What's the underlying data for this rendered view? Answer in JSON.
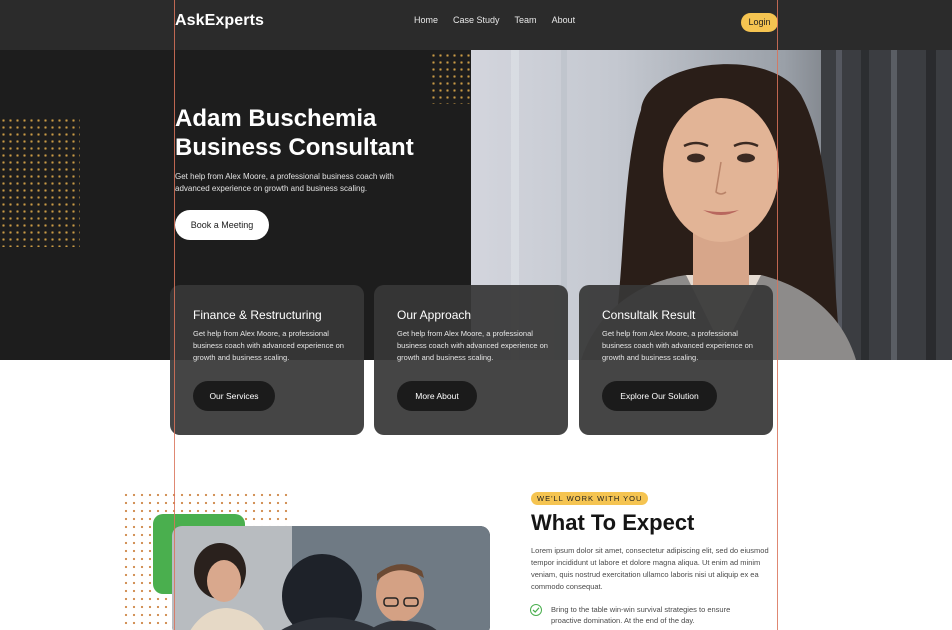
{
  "nav": {
    "logo": "AskExperts",
    "items": [
      "Home",
      "Case Study",
      "Team",
      "About"
    ],
    "login": "Login"
  },
  "hero": {
    "title": "Adam Buschemia Business Consultant",
    "description": "Get help from Alex Moore, a professional business coach with advanced experience on growth and business scaling.",
    "cta": "Book a Meeting"
  },
  "cards": [
    {
      "title": "Finance & Restructuring",
      "text": "Get help from Alex Moore, a professional business coach with advanced experience on growth and business scaling.",
      "button": "Our Services"
    },
    {
      "title": "Our Approach",
      "text": "Get help from Alex Moore, a professional business coach with advanced experience on growth and business scaling.",
      "button": "More About"
    },
    {
      "title": "Consultalk Result",
      "text": "Get help from Alex Moore, a professional business coach with advanced experience on growth and business scaling.",
      "button": "Explore Our Solution"
    }
  ],
  "expect": {
    "tag": "WE'LL WORK WITH YOU",
    "title": "What To Expect",
    "description": "Lorem ipsum dolor sit amet, consectetur adipiscing elit, sed do eiusmod tempor incididunt ut labore et dolore magna aliqua. Ut enim ad minim veniam, quis nostrud exercitation ullamco laboris nisi ut aliquip ex ea commodo consequat.",
    "bullet": "Bring to the table win-win survival strategies to ensure proactive domination. At the end of the day."
  },
  "colors": {
    "accent": "#f5c451",
    "dark": "#1d1d1d",
    "green": "#4aaf4e",
    "guide": "#d9735a"
  }
}
